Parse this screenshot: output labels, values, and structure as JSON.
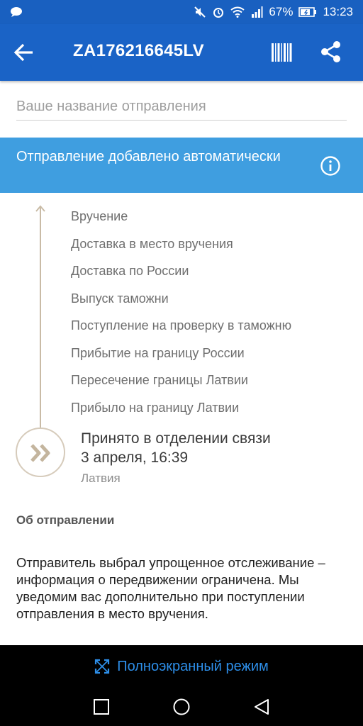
{
  "status_bar": {
    "battery": "67%",
    "time": "13:23"
  },
  "app_bar": {
    "title": "ZA176216645LV"
  },
  "name_field": {
    "placeholder": "Ваше название отправления"
  },
  "banner": {
    "text": "Отправление добавлено автоматически"
  },
  "timeline": {
    "events": [
      "Вручение",
      "Доставка в место вручения",
      "Доставка по России",
      "Выпуск таможни",
      "Поступление на проверку в таможню",
      "Прибытие на границу России",
      "Пересечение границы Латвии",
      "Прибыло на границу Латвии"
    ],
    "current": {
      "title": "Принято в отделении связи",
      "date": "3 апреля, 16:39",
      "country": "Латвия"
    }
  },
  "about": {
    "title": "Об отправлении",
    "text": "Отправитель выбрал упрощенное отслеживание – информация о передвижении ограничена. Мы уведомим вас дополнительно при поступлении отправления в место вручения."
  },
  "fullscreen": {
    "label": "Полноэкранный режим"
  },
  "colors": {
    "primary": "#1a63c6",
    "banner": "#3f9ee0",
    "timeline": "#c9bba6",
    "fullscreen_text": "#2d8ee8"
  }
}
